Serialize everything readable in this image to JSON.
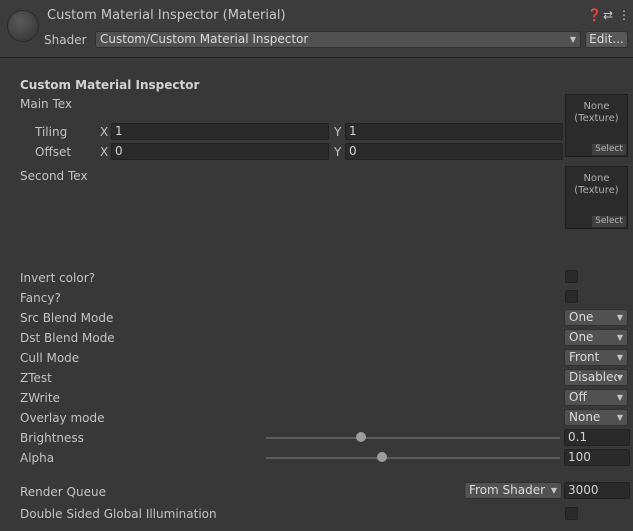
{
  "header": {
    "title": "Custom Material Inspector (Material)",
    "shader_label": "Shader",
    "shader_value": "Custom/Custom Material Inspector",
    "edit_label": "Edit...",
    "help_icon": "help-icon",
    "preset_icon": "preset-icon",
    "menu_icon": "kebab-menu-icon"
  },
  "section_title": "Custom Material Inspector",
  "main_tex": {
    "label": "Main Tex",
    "tiling_label": "Tiling",
    "offset_label": "Offset",
    "x_label": "X",
    "y_label": "Y",
    "tiling_x": "1",
    "tiling_y": "1",
    "offset_x": "0",
    "offset_y": "0",
    "texture_text": "None\n(Texture)",
    "select_label": "Select"
  },
  "second_tex": {
    "label": "Second Tex",
    "texture_text": "None\n(Texture)",
    "select_label": "Select"
  },
  "props": {
    "invert_color": {
      "label": "Invert color?",
      "checked": false
    },
    "fancy": {
      "label": "Fancy?",
      "checked": false
    },
    "src_blend": {
      "label": "Src Blend Mode",
      "value": "One"
    },
    "dst_blend": {
      "label": "Dst Blend Mode",
      "value": "One"
    },
    "cull_mode": {
      "label": "Cull Mode",
      "value": "Front"
    },
    "ztest": {
      "label": "ZTest",
      "value": "Disabled"
    },
    "zwrite": {
      "label": "ZWrite",
      "value": "Off"
    },
    "overlay": {
      "label": "Overlay mode",
      "value": "None"
    },
    "brightness": {
      "label": "Brightness",
      "value": "0.1"
    },
    "alpha": {
      "label": "Alpha",
      "value": "100"
    }
  },
  "render_queue": {
    "label": "Render Queue",
    "mode": "From Shader",
    "value": "3000"
  },
  "dsgi": {
    "label": "Double Sided Global Illumination",
    "checked": false
  }
}
